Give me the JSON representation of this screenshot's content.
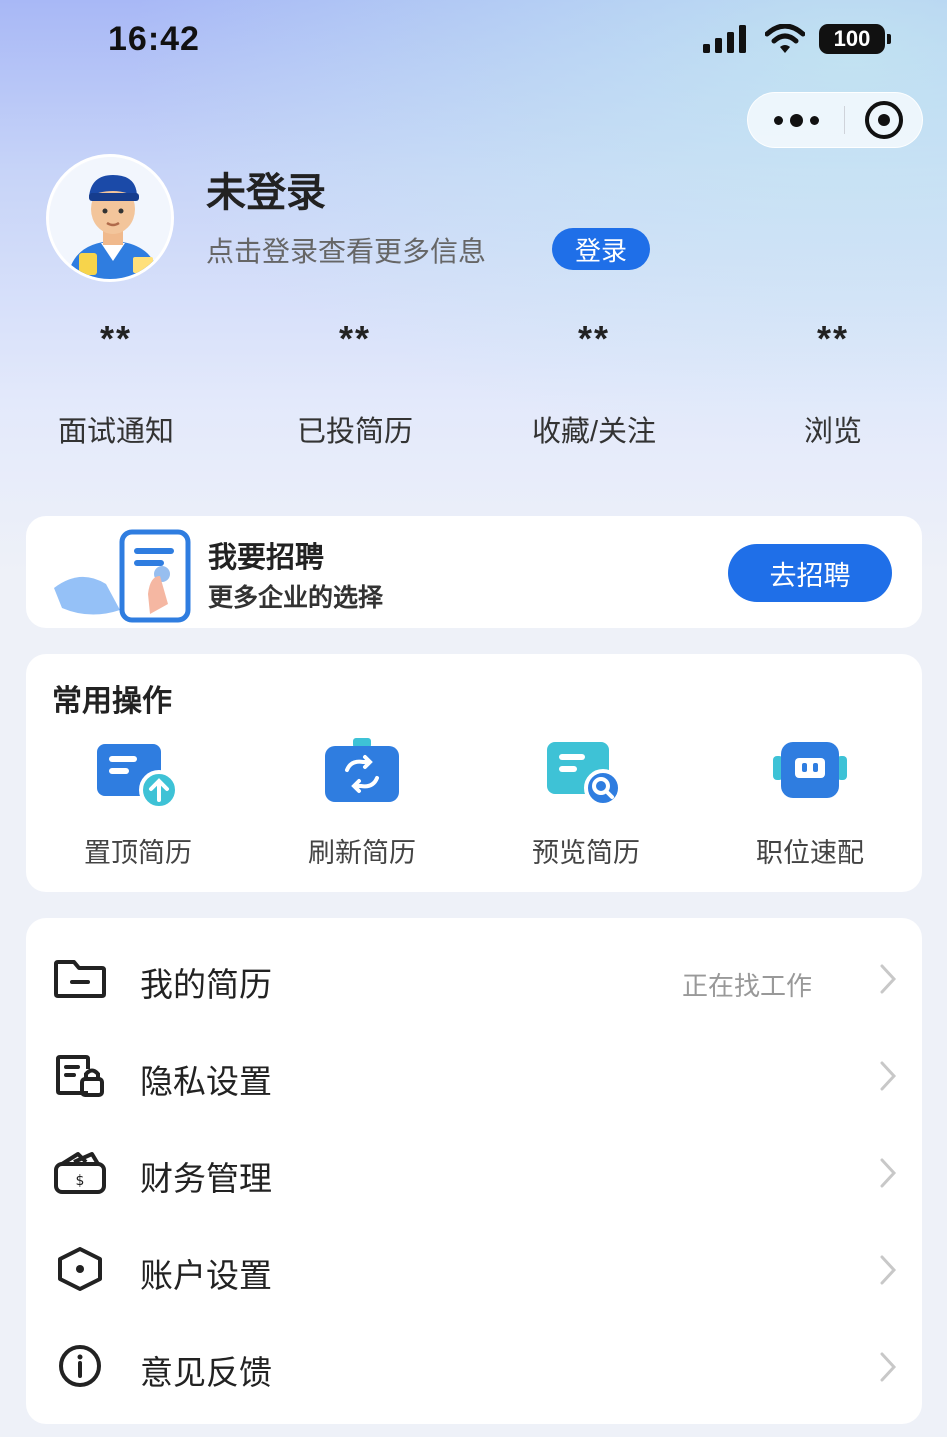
{
  "status_bar": {
    "time": "16:42",
    "battery": "100",
    "icons": [
      "signal-icon",
      "wifi-icon",
      "battery-icon"
    ]
  },
  "capsule": {
    "icons": [
      "more-dots-icon",
      "target-icon"
    ]
  },
  "profile": {
    "name": "未登录",
    "hint": "点击登录查看更多信息",
    "login_label": "登录"
  },
  "stats": [
    {
      "value": "**",
      "label": "面试通知"
    },
    {
      "value": "**",
      "label": "已投简历"
    },
    {
      "value": "**",
      "label": "收藏/关注"
    },
    {
      "value": "**",
      "label": "浏览"
    }
  ],
  "recruit": {
    "title": "我要招聘",
    "subtitle": "更多企业的选择",
    "button_label": "去招聘"
  },
  "common_ops": {
    "title": "常用操作",
    "items": [
      {
        "label": "置顶简历",
        "icon": "pin-resume-icon"
      },
      {
        "label": "刷新简历",
        "icon": "refresh-resume-icon"
      },
      {
        "label": "预览简历",
        "icon": "preview-resume-icon"
      },
      {
        "label": "职位速配",
        "icon": "job-match-icon"
      }
    ]
  },
  "menu": [
    {
      "label": "我的简历",
      "extra": "正在找工作",
      "icon": "folder-icon"
    },
    {
      "label": "隐私设置",
      "extra": "",
      "icon": "privacy-lock-icon"
    },
    {
      "label": "财务管理",
      "extra": "",
      "icon": "wallet-icon"
    },
    {
      "label": "账户设置",
      "extra": "",
      "icon": "hexagon-settings-icon"
    },
    {
      "label": "意见反馈",
      "extra": "",
      "icon": "info-icon"
    }
  ],
  "colors": {
    "accent": "#1f6fe8",
    "background": "#eef1f8",
    "card": "#ffffff"
  }
}
